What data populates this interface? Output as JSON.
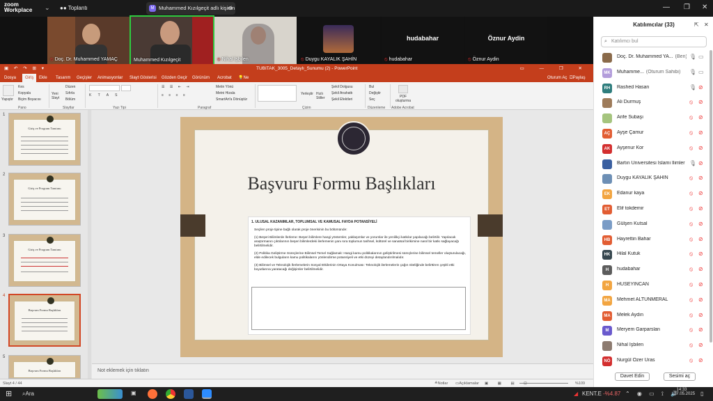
{
  "zoom": {
    "logo_line1": "zoom",
    "logo_line2": "Workplace",
    "meeting_label": "Toplantı",
    "view_label": "Muhammed Kızılgeçit adlı kişinin",
    "view_avatar": "M"
  },
  "videos": [
    {
      "name": "Doç. Dr. Muhammed YAMAÇ"
    },
    {
      "name": "Muhammed Kızılgeçit"
    },
    {
      "name": "Nihal İşbilen"
    },
    {
      "name": "Duygu KAYALIK ŞAHİN"
    },
    {
      "name": "hudabahar",
      "big": "hudabahar"
    },
    {
      "name": "Öznur Aydin",
      "big": "Öznur Aydin"
    }
  ],
  "ppt": {
    "window_title": "TUBITAK_3005_Detaylı_Sunumu (2) - PowerPoint",
    "user": "Oturum Aç",
    "share": "Paylaş",
    "menu": [
      "Dosya",
      "Giriş",
      "Ekle",
      "Tasarım",
      "Geçişler",
      "Animasyonlar",
      "Slayt Gösterisi",
      "Gözden Geçir",
      "Görünüm",
      "Acrobat"
    ],
    "tell_me": "Ne yapmak istediğinizi söyleyin...",
    "ribbon_groups": [
      "Pano",
      "Slaytlar",
      "Yazı Tipi",
      "Paragraf",
      "Çizim",
      "Düzenleme",
      "Adobe Acrobat"
    ],
    "ribbon_items": {
      "paste": "Yapıştır",
      "cut": "Kes",
      "copy": "Kopyala",
      "format_painter": "Biçim Boyacısı",
      "new_slide": "Yeni Slayt",
      "layout": "Düzen",
      "reset": "Sıfırla",
      "section": "Bölüm",
      "text_direction": "Metin Yönü",
      "align_text": "Metni Hizala",
      "smartart": "SmartArt'a Dönüştür",
      "arrange": "Yerleştir",
      "quick_styles": "Hızlı Stiller",
      "shape_fill": "Şekil Dolgusu",
      "shape_outline": "Şekil Anahattı",
      "shape_effects": "Şekil Efektleri",
      "find": "Bul",
      "replace": "Değiştir",
      "select": "Seç",
      "pdf": "PDF oluşturma"
    },
    "thumbnails": [
      {
        "num": "1",
        "title": "Giriş ve Program Tanıtımı"
      },
      {
        "num": "2",
        "title": "Giriş ve Program Tanıtımı"
      },
      {
        "num": "3",
        "title": "Giriş ve Program Tanıtımı"
      },
      {
        "num": "4",
        "title": "Başvuru Formu Başlıkları"
      },
      {
        "num": "5",
        "title": "Başvuru Formu Başlıkları"
      }
    ],
    "slide": {
      "title": "Başvuru Formu Başlıkları",
      "section_heading": "1. ULUSAL KAZANIMLAR, TOPLUMSAL VE KAMUSAL FAYDA POTANSİYELİ",
      "intro": "Seçilen proje tipine bağlı olarak proje önerisinin bu bölümünde:",
      "item1": "(1) Beşeri Bilimlerde İlerleme: Beşeri bilimlere hangi yöntemler, yaklaşımlar ve yorumlar ile yenilikçi katkılar yapılacağı belirtilir. Yapılacak araştırmanın çıktılarının beşeri bilimlerdeki ilerlemenin yanı sıra toplumun tarihsel, kültürel ve sanatsal birikimine nasıl bir katkı sağlayacağı belirtilmelidir.",
      "item2": "(2) Politika Geliştirme Süreçlerine Bilimsel Temel Sağlamak: Hangi kamu politikalarının geliştirilmesi süreçlerine bilimsel temeller oluşturulacağı, elde edilecek bulguların kamu politikalarını yönlendirme potansiyeli ve etki düzeyi detaylandırılmalıdır.",
      "item3": "(3) Bilimsel ve Teknolojik İlerlemelerin Sosyal Etkilerinin Ortaya Konulması: Teknolojik ilerlemelerin çağın niteliğinde belirttiren çeşitli etki boyutlarına yaratacağı değişimler belirtilmelidir."
    },
    "notes_placeholder": "Not eklemek için tıklatın",
    "status": {
      "slide_info": "Slayt 4 / 44",
      "notes": "Notlar",
      "comments": "Açıklamalar",
      "zoom": "%109"
    }
  },
  "participants": {
    "header": "Katılımcılar (33)",
    "search_placeholder": "Katılımcı bul",
    "list": [
      {
        "initials": "",
        "color": "#8a6a4a",
        "name": "Doç. Dr. Muhammed YA...",
        "suffix": "(Ben)",
        "mic_muted": false,
        "cam_off": false
      },
      {
        "initials": "MK",
        "color": "#b39ddb",
        "name": "Muhamme...",
        "suffix": "(Oturum Sahibi)",
        "mic_muted": false,
        "cam_off": false
      },
      {
        "initials": "RH",
        "color": "#2e7d7d",
        "name": "Rashed Hasan",
        "suffix": "",
        "mic_muted": false,
        "cam_off": true
      },
      {
        "initials": "",
        "color": "#9e7b5a",
        "name": "Ali Durmuş",
        "suffix": "",
        "mic_muted": true,
        "cam_off": true
      },
      {
        "initials": "",
        "color": "#a5c47e",
        "name": "Arife Subaşı",
        "suffix": "",
        "mic_muted": true,
        "cam_off": true
      },
      {
        "initials": "AÇ",
        "color": "#e25d33",
        "name": "Ayşe Çamur",
        "suffix": "",
        "mic_muted": true,
        "cam_off": true
      },
      {
        "initials": "AK",
        "color": "#d32f2f",
        "name": "Ayşenur Kor",
        "suffix": "",
        "mic_muted": true,
        "cam_off": true
      },
      {
        "initials": "",
        "color": "#3a5fa0",
        "name": "Bartın Üniversitesi İslami İlimler ...",
        "suffix": "",
        "mic_muted": false,
        "cam_off": true
      },
      {
        "initials": "",
        "color": "#6d8fb5",
        "name": "Duygu KAYALIK ŞAHİN",
        "suffix": "",
        "mic_muted": true,
        "cam_off": true
      },
      {
        "initials": "EK",
        "color": "#f2a541",
        "name": "Edanur kaya",
        "suffix": "",
        "mic_muted": true,
        "cam_off": true
      },
      {
        "initials": "ET",
        "color": "#e25d33",
        "name": "Elif tokdemir",
        "suffix": "",
        "mic_muted": true,
        "cam_off": true
      },
      {
        "initials": "",
        "color": "#7a9cc6",
        "name": "Gülşen Kutsal",
        "suffix": "",
        "mic_muted": true,
        "cam_off": true
      },
      {
        "initials": "HB",
        "color": "#e25d33",
        "name": "Hayrettin Bahar",
        "suffix": "",
        "mic_muted": true,
        "cam_off": true
      },
      {
        "initials": "HK",
        "color": "#37474f",
        "name": "Hilal Kutuk",
        "suffix": "",
        "mic_muted": true,
        "cam_off": true
      },
      {
        "initials": "H",
        "color": "#5c5c5c",
        "name": "hudabahar",
        "suffix": "",
        "mic_muted": true,
        "cam_off": true
      },
      {
        "initials": "H",
        "color": "#f2a541",
        "name": "HÜSEYİNCAN",
        "suffix": "",
        "mic_muted": true,
        "cam_off": true
      },
      {
        "initials": "MA",
        "color": "#f2a541",
        "name": "Mehmet ALTUNMERAL",
        "suffix": "",
        "mic_muted": true,
        "cam_off": true
      },
      {
        "initials": "MA",
        "color": "#e25d33",
        "name": "Melek Aydın",
        "suffix": "",
        "mic_muted": true,
        "cam_off": true
      },
      {
        "initials": "M",
        "color": "#6a5acd",
        "name": "Meryem Garparslan",
        "suffix": "",
        "mic_muted": true,
        "cam_off": true
      },
      {
        "initials": "",
        "color": "#8d7b70",
        "name": "Nihal İşbilen",
        "suffix": "",
        "mic_muted": true,
        "cam_off": true
      },
      {
        "initials": "NÖ",
        "color": "#d32f2f",
        "name": "Nurgül Özer Uras",
        "suffix": "",
        "mic_muted": true,
        "cam_off": true
      }
    ],
    "invite_button": "Davet Edin",
    "unmute_button": "Sesimi aç"
  },
  "taskbar": {
    "search": "Ara",
    "stock_name": "KENT.E",
    "stock_change": "-%4.87",
    "time": "14:33",
    "date": "27.05.2025"
  }
}
